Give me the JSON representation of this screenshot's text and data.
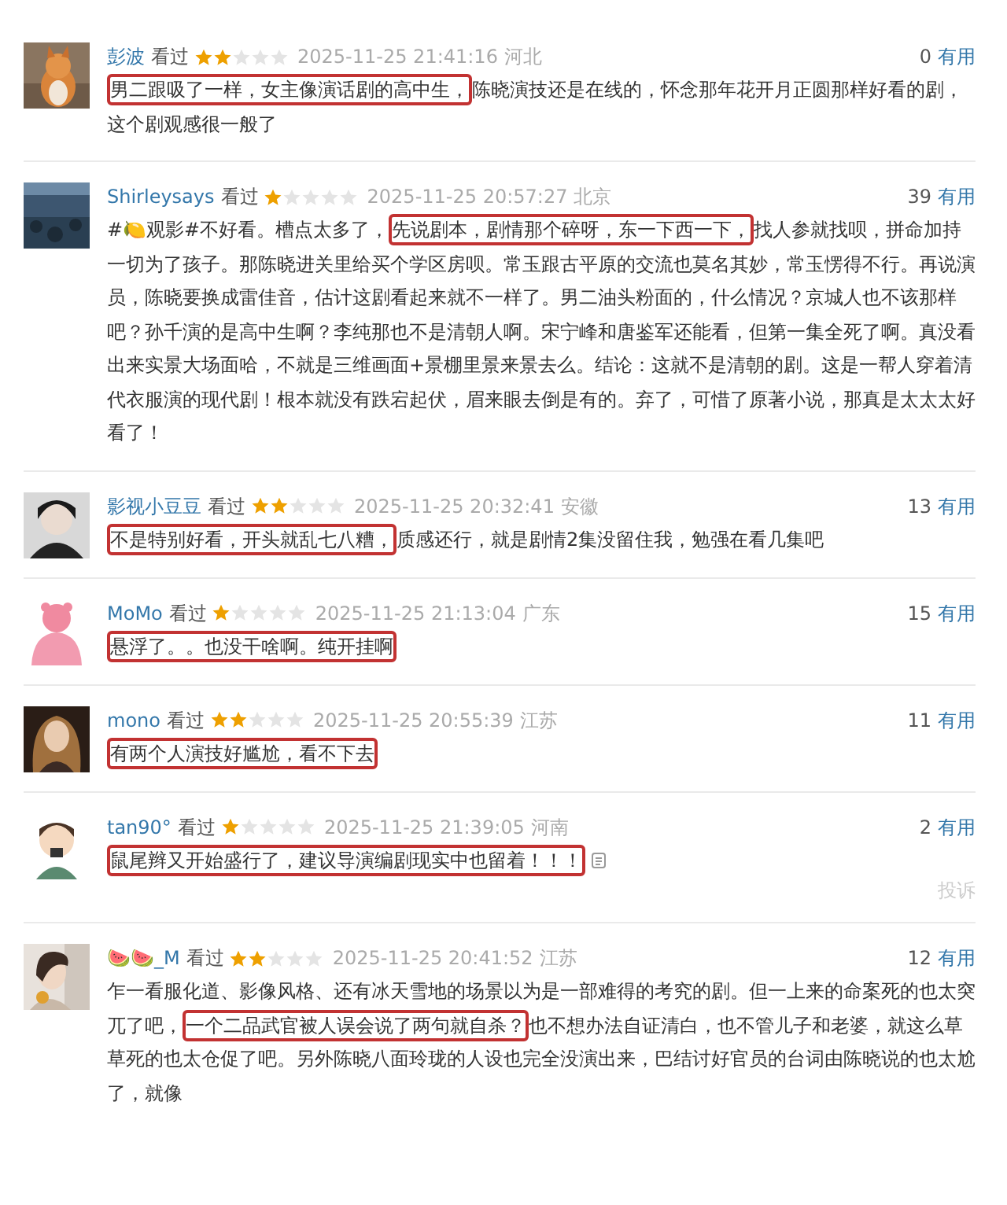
{
  "reviews": [
    {
      "user": "彭波",
      "status": "看过",
      "stars": 2,
      "time": "2025-11-25 21:41:16",
      "location": "河北",
      "useful_count": "0",
      "useful_label": "有用",
      "comment": [
        {
          "text": "男二跟吸了一样，女主像演话剧的高中生，",
          "highlighted": true
        },
        {
          "text": "陈晓演技还是在线的，怀念那年花开月正圆那样好看的剧，这个剧观感很一般了",
          "highlighted": false
        }
      ]
    },
    {
      "user": "Shirleysays",
      "status": "看过",
      "stars": 1,
      "time": "2025-11-25 20:57:27",
      "location": "北京",
      "useful_count": "39",
      "useful_label": "有用",
      "comment": [
        {
          "text": "#🍋观影#不好看。槽点太多了，",
          "highlighted": false
        },
        {
          "text": "先说剧本，剧情那个碎呀，东一下西一下，",
          "highlighted": true
        },
        {
          "text": "找人参就找呗，拼命加持一切为了孩子。那陈晓进关里给买个学区房呗。常玉跟古平原的交流也莫名其妙，常玉愣得不行。再说演员，陈晓要换成雷佳音，估计这剧看起来就不一样了。男二油头粉面的，什么情况？京城人也不该那样吧？孙千演的是高中生啊？李纯那也不是清朝人啊。宋宁峰和唐鉴军还能看，但第一集全死了啊。真没看出来实景大场面哈，不就是三维画面+景棚里景来景去么。结论：这就不是清朝的剧。这是一帮人穿着清代衣服演的现代剧！根本就没有跌宕起伏，眉来眼去倒是有的。弃了，可惜了原著小说，那真是太太太好看了！",
          "highlighted": false
        }
      ]
    },
    {
      "user": "影视小豆豆",
      "status": "看过",
      "stars": 2,
      "time": "2025-11-25 20:32:41",
      "location": "安徽",
      "useful_count": "13",
      "useful_label": "有用",
      "comment": [
        {
          "text": "不是特别好看，开头就乱七八糟，",
          "highlighted": true
        },
        {
          "text": "质感还行，就是剧情2集没留住我，勉强在看几集吧",
          "highlighted": false
        }
      ]
    },
    {
      "user": "MoMo",
      "status": "看过",
      "stars": 1,
      "time": "2025-11-25 21:13:04",
      "location": "广东",
      "useful_count": "15",
      "useful_label": "有用",
      "comment": [
        {
          "text": "悬浮了。。也没干啥啊。纯开挂啊",
          "highlighted": true
        }
      ]
    },
    {
      "user": "mono",
      "status": "看过",
      "stars": 2,
      "time": "2025-11-25 20:55:39",
      "location": "江苏",
      "useful_count": "11",
      "useful_label": "有用",
      "comment": [
        {
          "text": "有两个人演技好尴尬，看不下去",
          "highlighted": true
        }
      ]
    },
    {
      "user": "tan90°",
      "status": "看过",
      "stars": 1,
      "time": "2025-11-25 21:39:05",
      "location": "河南",
      "useful_count": "2",
      "useful_label": "有用",
      "comment": [
        {
          "text": "鼠尾辫又开始盛行了，建议导演编剧现实中也留着！！！",
          "highlighted": true
        }
      ],
      "report": "投诉"
    },
    {
      "user": "🍉🍉_M",
      "status": "看过",
      "stars": 2,
      "time": "2025-11-25 20:41:52",
      "location": "江苏",
      "useful_count": "12",
      "useful_label": "有用",
      "comment": [
        {
          "text": "乍一看服化道、影像风格、还有冰天雪地的场景以为是一部难得的考究的剧。但一上来的命案死的也太突兀了吧，",
          "highlighted": false
        },
        {
          "text": "一个二品武官被人误会说了两句就自杀？",
          "highlighted": true
        },
        {
          "text": "也不想办法自证清白，也不管儿子和老婆，就这么草草死的也太仓促了吧。另外陈晓八面玲珑的人设也完全没演出来，巴结讨好官员的台词由陈晓说的也太尬了，就像",
          "highlighted": false
        }
      ]
    }
  ]
}
